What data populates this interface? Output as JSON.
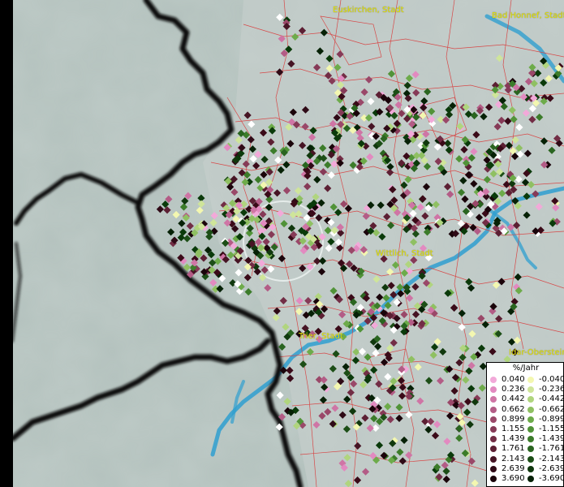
{
  "map": {
    "cities": [
      {
        "key": "euskirchen",
        "name": "Euskirchen, Stadt"
      },
      {
        "key": "badhonnef",
        "name": "Bad Honnef, Stadt"
      },
      {
        "key": "wittlich",
        "name": "Wittlich, Stadt"
      },
      {
        "key": "trier",
        "name": "Trier, Stadt"
      },
      {
        "key": "idar",
        "name": "Idar-Oberstein"
      }
    ],
    "colors": {
      "background_gray": "#b7c4c0",
      "border": "#111111",
      "admin_lines": "#d93b3b",
      "river": "#2f9fd0",
      "highlight_circle": "#e6f0ee"
    }
  },
  "legend": {
    "title": "%/Jahr",
    "positive": [
      {
        "value": "0.040",
        "color": "#f2a9d9"
      },
      {
        "value": "0.236",
        "color": "#e28ac0"
      },
      {
        "value": "0.442",
        "color": "#cf75a5"
      },
      {
        "value": "0.662",
        "color": "#b35c86"
      },
      {
        "value": "0.899",
        "color": "#9a4869"
      },
      {
        "value": "1.155",
        "color": "#863a57"
      },
      {
        "value": "1.439",
        "color": "#722d45"
      },
      {
        "value": "1.761",
        "color": "#5c1f33"
      },
      {
        "value": "2.143",
        "color": "#461424"
      },
      {
        "value": "2.639",
        "color": "#2f0a16"
      },
      {
        "value": "3.690",
        "color": "#1a040a"
      }
    ],
    "negative": [
      {
        "value": "-0.040",
        "color": "#f3f7b0"
      },
      {
        "value": "-0.236",
        "color": "#cfe59a"
      },
      {
        "value": "-0.442",
        "color": "#b0d57e"
      },
      {
        "value": "-0.662",
        "color": "#8fc062"
      },
      {
        "value": "-0.899",
        "color": "#6dab4a"
      },
      {
        "value": "-1.155",
        "color": "#519338"
      },
      {
        "value": "-1.439",
        "color": "#3c7c2a"
      },
      {
        "value": "-1.761",
        "color": "#2a6520"
      },
      {
        "value": "-2.143",
        "color": "#1c4e16"
      },
      {
        "value": "-2.639",
        "color": "#10380d"
      },
      {
        "value": "-3.690",
        "color": "#062106"
      }
    ]
  }
}
